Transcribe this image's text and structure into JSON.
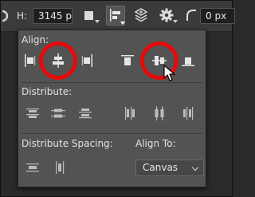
{
  "optionsbar": {
    "h_label": "H:",
    "h_value": "3145 p",
    "stroke_value": "0 px"
  },
  "align_panel": {
    "align_title": "Align:",
    "distribute_title": "Distribute:",
    "distribute_spacing_title": "Distribute Spacing:",
    "align_to_title": "Align To:",
    "align_to_value": "Canvas",
    "icons": {
      "align_left": "align-left-edges-icon",
      "align_hcenter": "align-horizontal-centers-icon",
      "align_right": "align-right-edges-icon",
      "align_top": "align-top-edges-icon",
      "align_vcenter": "align-vertical-centers-icon",
      "align_bottom": "align-bottom-edges-icon"
    }
  },
  "colors": {
    "highlight_ring": "#e30b0b",
    "panel_bg": "#535353",
    "toolbar_bg": "#3b3b3b"
  }
}
